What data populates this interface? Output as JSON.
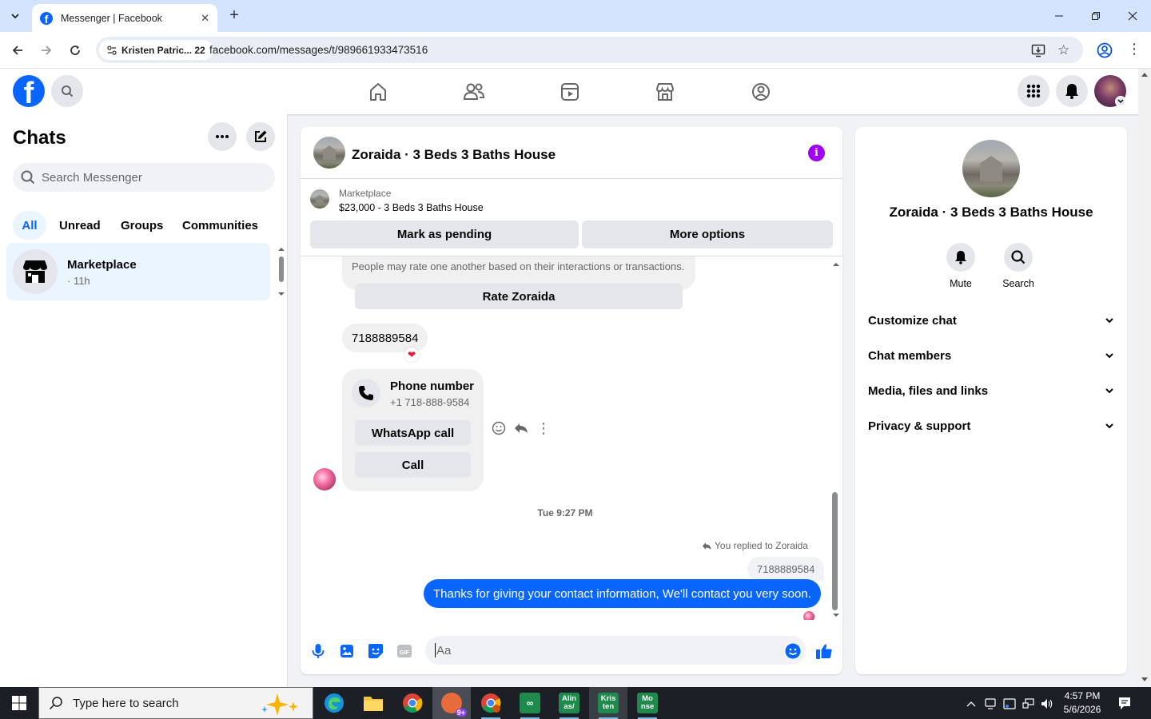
{
  "browser": {
    "tab_title": "Messenger | Facebook",
    "profile_chip": "Kristen Patric... 22",
    "url": "facebook.com/messages/t/989661933473516"
  },
  "sidebar": {
    "title": "Chats",
    "search_placeholder": "Search Messenger",
    "filters": [
      "All",
      "Unread",
      "Groups",
      "Communities"
    ],
    "active_filter": "All",
    "chats": [
      {
        "name": "Marketplace",
        "time": "· 11h"
      }
    ]
  },
  "conversation": {
    "title": "Zoraida · 3 Beds 3 Baths House",
    "marketplace_label": "Marketplace",
    "listing": "$23,000 - 3 Beds 3 Baths House",
    "mark_pending": "Mark as pending",
    "more_options": "More options",
    "rate_note": "People may rate one another based on their interactions or transactions.",
    "rate_button": "Rate Zoraida",
    "phone_message": "7188889584",
    "phone_card": {
      "title": "Phone number",
      "number": "+1 718-888-9584",
      "whatsapp": "WhatsApp call",
      "call": "Call"
    },
    "timestamp": "Tue 9:27 PM",
    "replied_note": "You replied to Zoraida",
    "quoted": "7188889584",
    "sent_message": "Thanks for giving your contact information, We'll contact you very soon.",
    "composer_placeholder": "Aa"
  },
  "details": {
    "name": "Zoraida · 3 Beds 3 Baths House",
    "actions": [
      "Mute",
      "Search"
    ],
    "sections": [
      "Customize chat",
      "Chat members",
      "Media, files and links",
      "Privacy & support"
    ]
  },
  "taskbar": {
    "search_placeholder": "Type here to search",
    "badge": "9+",
    "tile_aliases": "Alin as/",
    "tile_kristen": "Kris ten",
    "tile_monse": "Mo nse",
    "time": "4:57 PM",
    "date": "5/6/2026"
  },
  "colors": {
    "fb_blue": "#0866ff",
    "info_purple": "#a100f2",
    "heart_red": "#e41e3f"
  }
}
